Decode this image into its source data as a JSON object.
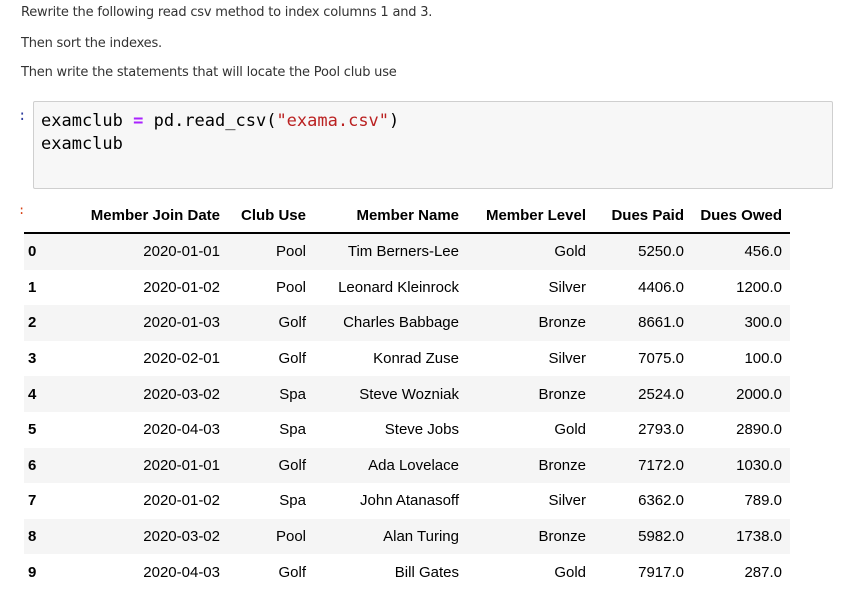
{
  "question": {
    "lines": [
      "Rewrite the following read csv method to index columns 1 and 3.",
      "Then sort the indexes.",
      "Then write the statements that will locate the Pool  club use"
    ]
  },
  "cell_in": {
    "prompt": ":",
    "code": {
      "line1": {
        "var": "examclub ",
        "op": "=",
        "call_open": " pd.read_csv(",
        "string": "\"exama.csv\"",
        "call_close": ")"
      },
      "line2": "examclub"
    }
  },
  "cell_out": {
    "prompt": ":",
    "dataframe": {
      "columns": [
        "",
        "Member Join Date",
        "Club Use",
        "Member Name",
        "Member Level",
        "Dues Paid",
        "Dues Owed"
      ],
      "rows": [
        {
          "index": "0",
          "join_date": "2020-01-01",
          "club_use": "Pool",
          "name": "Tim Berners-Lee",
          "level": "Gold",
          "dues_paid": "5250.0",
          "dues_owed": "456.0"
        },
        {
          "index": "1",
          "join_date": "2020-01-02",
          "club_use": "Pool",
          "name": "Leonard Kleinrock",
          "level": "Silver",
          "dues_paid": "4406.0",
          "dues_owed": "1200.0"
        },
        {
          "index": "2",
          "join_date": "2020-01-03",
          "club_use": "Golf",
          "name": "Charles Babbage",
          "level": "Bronze",
          "dues_paid": "8661.0",
          "dues_owed": "300.0"
        },
        {
          "index": "3",
          "join_date": "2020-02-01",
          "club_use": "Golf",
          "name": "Konrad Zuse",
          "level": "Silver",
          "dues_paid": "7075.0",
          "dues_owed": "100.0"
        },
        {
          "index": "4",
          "join_date": "2020-03-02",
          "club_use": "Spa",
          "name": "Steve Wozniak",
          "level": "Bronze",
          "dues_paid": "2524.0",
          "dues_owed": "2000.0"
        },
        {
          "index": "5",
          "join_date": "2020-04-03",
          "club_use": "Spa",
          "name": "Steve Jobs",
          "level": "Gold",
          "dues_paid": "2793.0",
          "dues_owed": "2890.0"
        },
        {
          "index": "6",
          "join_date": "2020-01-01",
          "club_use": "Golf",
          "name": "Ada Lovelace",
          "level": "Bronze",
          "dues_paid": "7172.0",
          "dues_owed": "1030.0"
        },
        {
          "index": "7",
          "join_date": "2020-01-02",
          "club_use": "Spa",
          "name": "John Atanasoff",
          "level": "Silver",
          "dues_paid": "6362.0",
          "dues_owed": "789.0"
        },
        {
          "index": "8",
          "join_date": "2020-03-02",
          "club_use": "Pool",
          "name": "Alan Turing",
          "level": "Bronze",
          "dues_paid": "5982.0",
          "dues_owed": "1738.0"
        },
        {
          "index": "9",
          "join_date": "2020-04-03",
          "club_use": "Golf",
          "name": "Bill Gates",
          "level": "Gold",
          "dues_paid": "7917.0",
          "dues_owed": "287.0"
        }
      ]
    }
  },
  "colors": {
    "code_bg": "#f7f7f7",
    "code_border": "#cfcfcf",
    "operator": "#aa22ff",
    "string": "#ba2121",
    "row_stripe": "#f5f5f5"
  }
}
